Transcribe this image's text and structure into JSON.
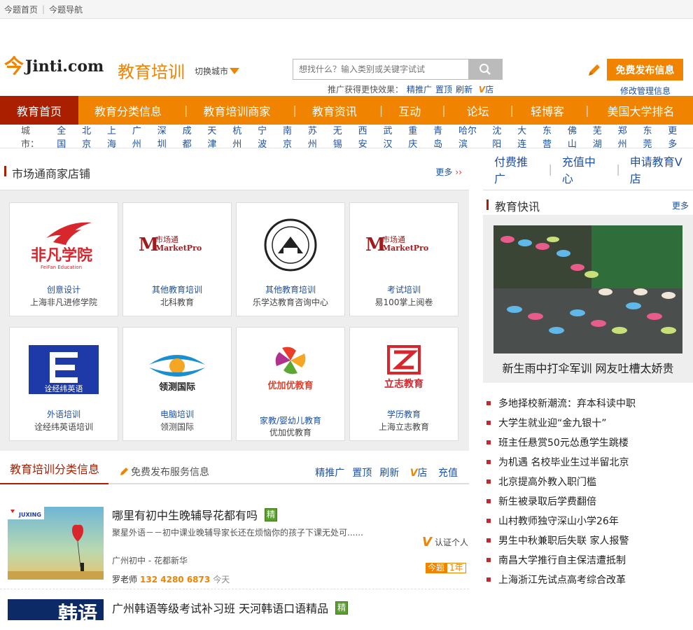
{
  "topbar": {
    "home": "今题首页",
    "nav": "今题导航"
  },
  "header": {
    "logo_mark": "今",
    "logo_text": "Jinti.com",
    "site_name": "教育培训",
    "city_switch": "切换城市",
    "search_placeholder": "想找什么？输入类别或关键字试试",
    "promo_prefix": "推广获得更快效果：",
    "promo_links": [
      "精推广",
      "置顶",
      "刷新"
    ],
    "promo_v": "V",
    "promo_v_suffix": "店",
    "publish_button": "免费发布信息",
    "manage_link": "修改管理信息"
  },
  "nav": {
    "items": [
      "教育首页",
      "教育分类信息",
      "教育培训商家",
      "教育资讯",
      "互动",
      "论坛",
      "轻博客",
      "美国大学排名"
    ],
    "separator": "|"
  },
  "cities": {
    "label": "城市：",
    "items": [
      "全国",
      "北京",
      "上海",
      "广州",
      "深圳",
      "成都",
      "天津",
      "杭州",
      "宁波",
      "南京",
      "苏州",
      "无锡",
      "西安",
      "武汉",
      "重庆",
      "青岛",
      "哈尔滨",
      "沈阳",
      "大连",
      "东营",
      "佛山",
      "芜湖",
      "郑州",
      "东莞",
      "更多"
    ]
  },
  "shops": {
    "title": "市场通商家店铺",
    "more": "更多",
    "cards": [
      {
        "category": "创意设计",
        "name": "上海非凡进修学院",
        "logo_text": "非凡学院",
        "logo_sub": "FeiFan Education"
      },
      {
        "category": "其他教育培训",
        "name": "北科教育",
        "logo_text": "MarketPro",
        "logo_cn": "市场通"
      },
      {
        "category": "其他教育培训",
        "name": "乐学达教育咨询中心"
      },
      {
        "category": "考试培训",
        "name": "易100掌上阅卷",
        "logo_text": "MarketPro",
        "logo_cn": "市场通"
      },
      {
        "category": "外语培训",
        "name": "诠经纬英语培训",
        "logo_text": "诠经纬英语"
      },
      {
        "category": "电脑培训",
        "name": "领测国际",
        "logo_text": "领测国际"
      },
      {
        "category": "家教/婴幼儿教育",
        "name": "优加优教育",
        "logo_text": "优加优教育"
      },
      {
        "category": "学历教育",
        "name": "上海立志教育",
        "logo_text": "立志教育"
      }
    ]
  },
  "listing_tabs": {
    "active": "教育培训分类信息",
    "publish": "免费发布服务信息",
    "links": [
      "精推广",
      "置顶",
      "刷新"
    ],
    "v": "V",
    "v_suffix": "店",
    "recharge": "充值"
  },
  "listings": [
    {
      "title": "哪里有初中生晚辅导花都有吗",
      "badge": "精",
      "desc": "聚星外语－－初中课业晚辅导家长还在烦恼你的孩子下课无处可......",
      "location": "广州初中  - 花都新华",
      "verified": "认证个人",
      "v": "V",
      "years_a": "今题",
      "years_b": "1年",
      "contact_name": "罗老师",
      "phone": "132 4280 6873",
      "time": "今天",
      "thumb_brand": "JUXING"
    },
    {
      "title": "广州韩语等级考试补习班 天河韩语口语精品",
      "badge": "精",
      "thumb_text": "韩语"
    }
  ],
  "right_tabs": [
    "付费推广",
    "充值中心",
    "申请教育V店"
  ],
  "news": {
    "title": "教育快讯",
    "more": "更多",
    "feature_caption": "新生雨中打伞军训 网友吐槽太娇贵",
    "items": [
      "多地择校新潮流：弃本科读中职",
      "大学生就业迎“金九银十”",
      "班主任悬赏50元怂恿学生跳楼",
      "为机遇 名校毕业生过半留北京",
      "北京提高外教入职门槛",
      "新生被录取后学费翻倍",
      "山村教师独守深山小学26年",
      "男生中秋兼职后失联 家人报警",
      "南昌大学推行自主保洁遭抵制",
      "上海浙江先试点高考综合改革"
    ]
  },
  "colors": {
    "brand": "#f08300",
    "nav_active": "#aa1f00",
    "link": "#1e50a2"
  }
}
